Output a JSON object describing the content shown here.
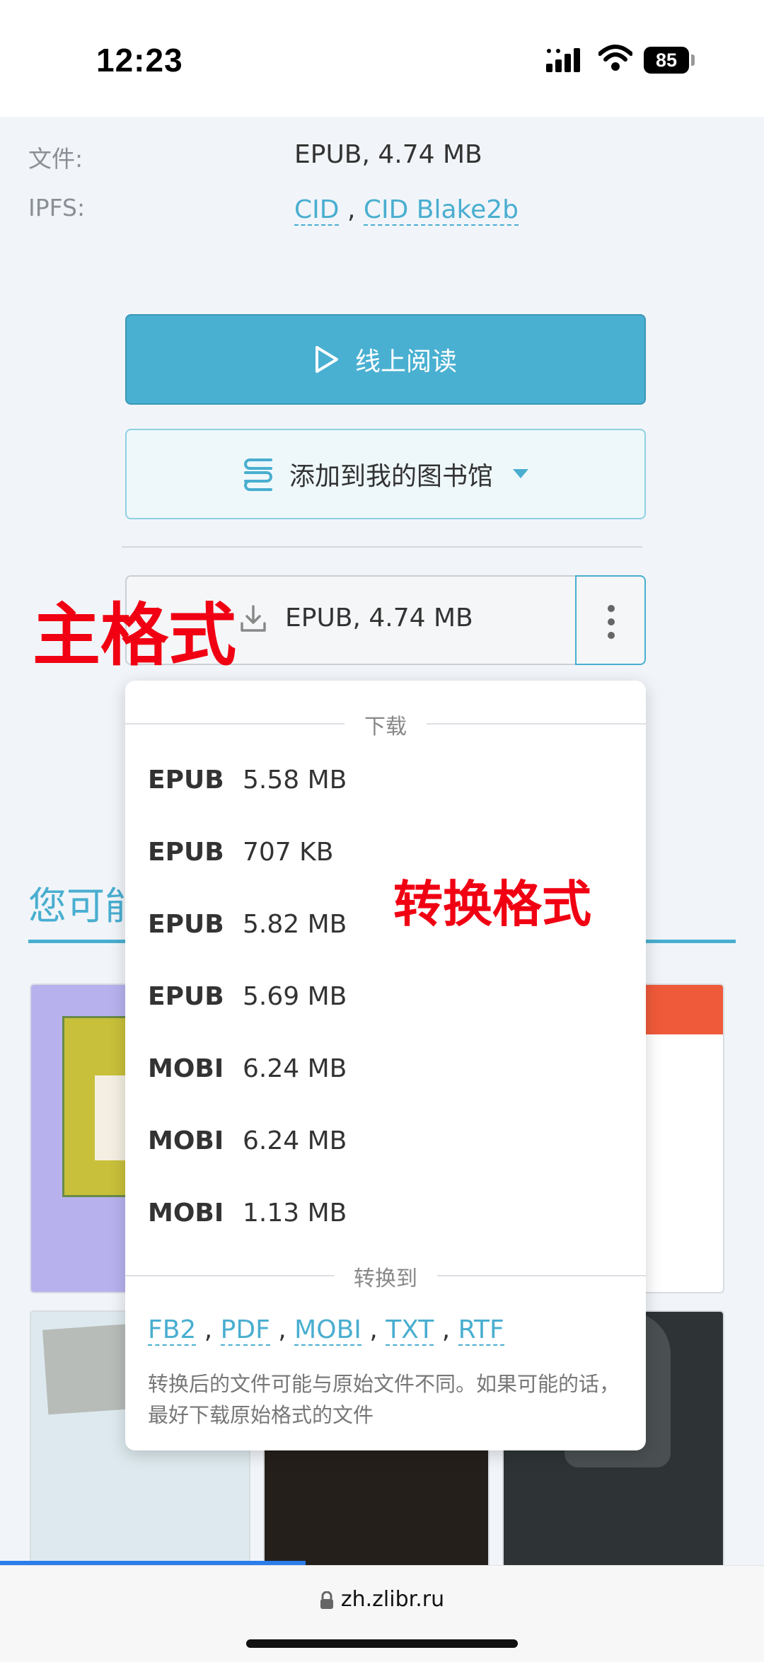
{
  "status": {
    "time": "12:23",
    "battery": "85"
  },
  "meta": {
    "file_label": "文件:",
    "file_value": "EPUB, 4.74 MB",
    "ipfs_label": "IPFS:",
    "ipfs_links": [
      "CID",
      "CID Blake2b"
    ],
    "ipfs_sep": ","
  },
  "buttons": {
    "read_online": "线上阅读",
    "add_library": "添加到我的图书馆"
  },
  "main_format": {
    "label": "EPUB, 4.74 MB"
  },
  "annotations": {
    "main_format": "主格式",
    "converted": "转换格式"
  },
  "background": {
    "section_heading": "您可能"
  },
  "dropdown": {
    "download_header": "下载",
    "items": [
      {
        "format": "EPUB",
        "size": "5.58 MB"
      },
      {
        "format": "EPUB",
        "size": "707 KB"
      },
      {
        "format": "EPUB",
        "size": "5.82 MB"
      },
      {
        "format": "EPUB",
        "size": "5.69 MB"
      },
      {
        "format": "MOBI",
        "size": "6.24 MB"
      },
      {
        "format": "MOBI",
        "size": "6.24 MB"
      },
      {
        "format": "MOBI",
        "size": "1.13 MB"
      }
    ],
    "convert_header": "转换到",
    "convert_links": [
      "FB2",
      "PDF",
      "MOBI",
      "TXT",
      "RTF"
    ],
    "convert_sep": ",",
    "convert_note": "转换后的文件可能与原始文件不同。如果可能的话，最好下载原始格式的文件"
  },
  "browser": {
    "url": "zh.zlibr.ru",
    "load_progress": 0.4
  },
  "colors": {
    "accent": "#49b0d2",
    "annotation": "#f00012",
    "progress": "#2b7de9"
  },
  "icons": [
    "play-icon",
    "library-icon",
    "caret-down-icon",
    "download-icon",
    "more-vertical-icon",
    "lock-icon",
    "signal-icon",
    "wifi-icon"
  ]
}
